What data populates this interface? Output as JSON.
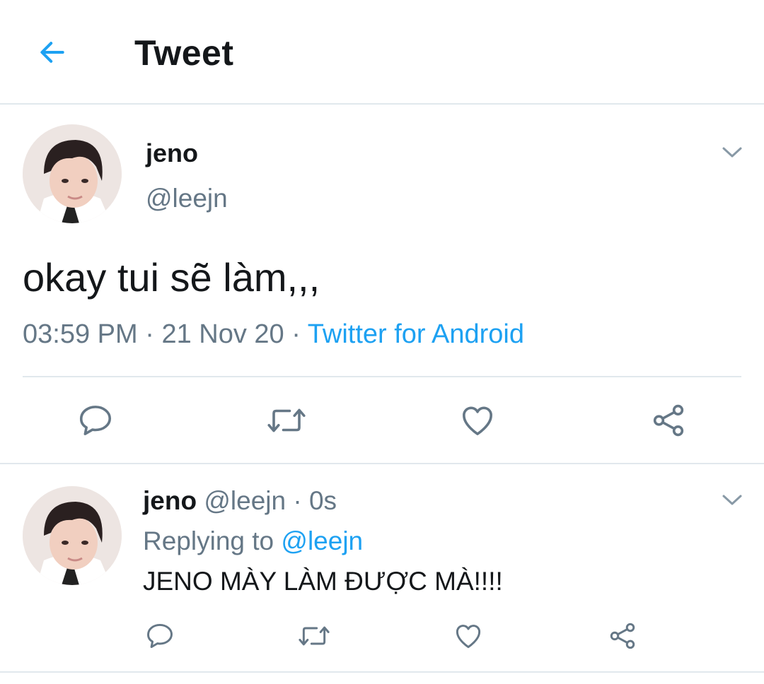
{
  "header": {
    "title": "Tweet",
    "back_icon": "arrow-left-icon"
  },
  "colors": {
    "accent": "#1da1f2",
    "secondary_text": "#657786",
    "primary_text": "#14171a",
    "divider": "#e1e8ed"
  },
  "tweet": {
    "author_name": "jeno",
    "author_handle": "@leejn",
    "text": "okay tui sẽ làm,,,",
    "time": "03:59 PM",
    "sep1": " · ",
    "date": "21 Nov 20",
    "sep2": " · ",
    "source": "Twitter for Android",
    "actions": [
      "reply-icon",
      "retweet-icon",
      "like-icon",
      "share-icon"
    ]
  },
  "reply": {
    "author_name": "jeno",
    "author_handle": "@leejn",
    "sep": " · ",
    "age": "0s",
    "replying_label": "Replying to ",
    "replying_to": "@leejn",
    "text": "JENO MÀY LÀM ĐƯỢC MÀ!!!!",
    "actions": [
      "reply-icon",
      "retweet-icon",
      "like-icon",
      "share-icon"
    ]
  }
}
